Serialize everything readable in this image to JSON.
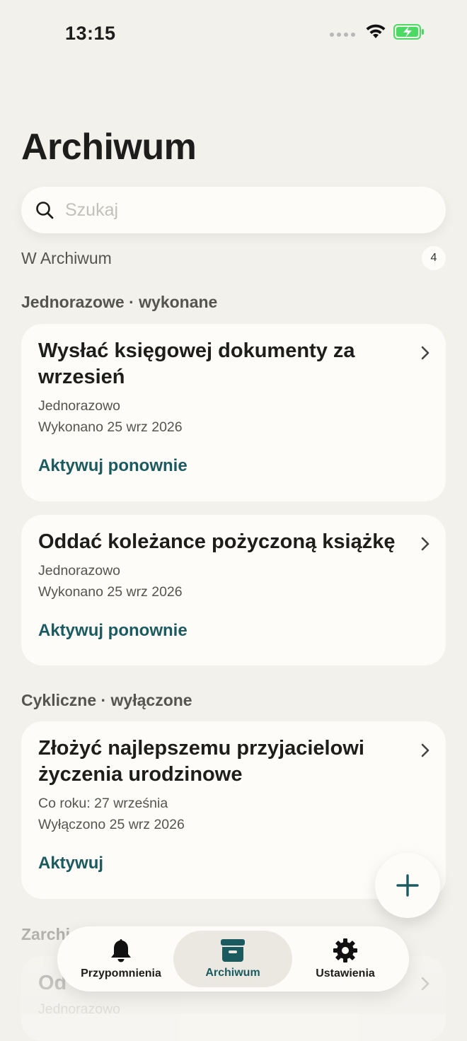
{
  "status_bar": {
    "time": "13:15"
  },
  "page_title": "Archiwum",
  "search": {
    "placeholder": "Szukaj"
  },
  "archive_section": {
    "label": "W Archiwum",
    "count": "4"
  },
  "groups": [
    {
      "header": "Jednorazowe · wykonane",
      "items": [
        {
          "title": "Wysłać księgowej dokumenty za wrzesień",
          "type": "Jednorazowo",
          "status": "Wykonano 25 wrz 2026",
          "action": "Aktywuj ponownie"
        },
        {
          "title": "Oddać koleżance pożyczoną książkę",
          "type": "Jednorazowo",
          "status": "Wykonano 25 wrz 2026",
          "action": "Aktywuj ponownie"
        }
      ]
    },
    {
      "header": "Cykliczne · wyłączone",
      "items": [
        {
          "title": "Złożyć najlepszemu przyjacielowi życzenia urodzinowe",
          "type": "Co roku: 27 września",
          "status": "Wyłączono 25 wrz 2026",
          "action": "Aktywuj"
        }
      ]
    }
  ],
  "partial": {
    "header": "Zarchi",
    "title": "Od",
    "type": "Jednorazowo"
  },
  "tabs": [
    {
      "label": "Przypomnienia",
      "icon": "bell-icon"
    },
    {
      "label": "Archiwum",
      "icon": "archive-box-icon",
      "active": true
    },
    {
      "label": "Ustawienia",
      "icon": "gear-icon"
    }
  ],
  "colors": {
    "accent": "#1b5b60",
    "background": "#f3f1ec",
    "card": "#fdfcf8",
    "battery": "#4cd964"
  }
}
